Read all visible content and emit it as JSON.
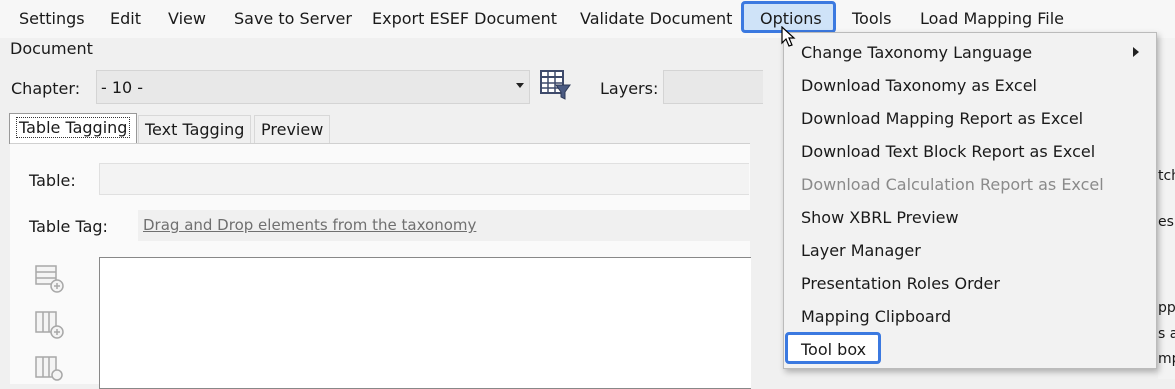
{
  "menubar": {
    "items": [
      "Settings",
      "Edit",
      "View",
      "Save to Server",
      "Export ESEF Document",
      "Validate Document",
      "Options",
      "Tools",
      "Load Mapping File"
    ]
  },
  "document": {
    "section_label": "Document",
    "chapter_label": "Chapter:",
    "chapter_value": "- 10 -",
    "layers_label": "Layers:"
  },
  "tabs": [
    "Table Tagging",
    "Text Tagging",
    "Preview"
  ],
  "table_tagging": {
    "table_label": "Table:",
    "table_value": "",
    "table_tag_label": "Table Tag:",
    "table_tag_hint": "Drag and Drop elements from the taxonomy"
  },
  "options_menu": {
    "items": [
      {
        "label": "Change Taxonomy Language",
        "submenu": true,
        "enabled": true
      },
      {
        "label": "Download Taxonomy as Excel",
        "enabled": true
      },
      {
        "label": "Download Mapping Report as Excel",
        "enabled": true
      },
      {
        "label": "Download Text Block Report as Excel",
        "enabled": true
      },
      {
        "label": "Download Calculation Report as Excel",
        "enabled": false
      },
      {
        "label": "Show XBRL Preview",
        "enabled": true
      },
      {
        "label": "Layer Manager",
        "enabled": true
      },
      {
        "label": "Presentation Roles Order",
        "enabled": true
      },
      {
        "label": "Mapping Clipboard",
        "enabled": true
      },
      {
        "label": "Tool box",
        "enabled": true
      }
    ]
  },
  "right_fragments": [
    "tch",
    "es",
    "pp",
    "s a",
    "mpl"
  ],
  "colors": {
    "highlight_border": "#3b79e0",
    "menu_background": "#f2f2f2",
    "disabled_text": "#8a8a8a"
  }
}
